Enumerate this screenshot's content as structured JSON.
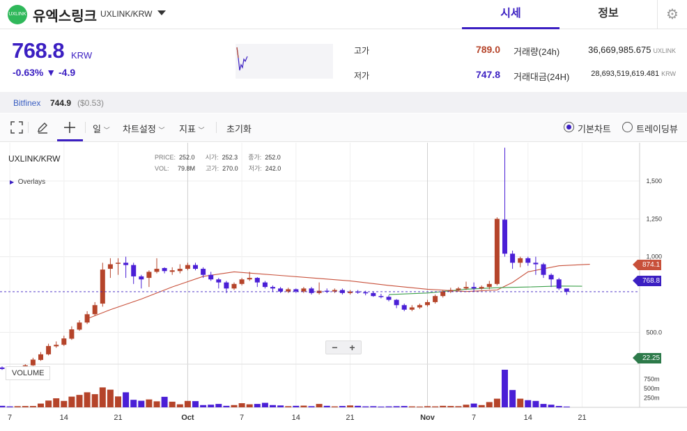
{
  "header": {
    "logo_text": "UXLINK",
    "coin_name": "유엑스링크",
    "pair": "UXLINK/KRW",
    "tabs": [
      {
        "label": "시세",
        "active": true
      },
      {
        "label": "정보",
        "active": false
      }
    ]
  },
  "summary": {
    "price": "768.8",
    "price_unit": "KRW",
    "change_pct": "-0.63%",
    "change_abs": "▼ -4.9",
    "high_label": "고가",
    "high_value": "789.0",
    "low_label": "저가",
    "low_value": "747.8",
    "vol_label": "거래량(24h)",
    "vol_value": "36,669,985.675",
    "vol_unit": "UXLINK",
    "amount_label": "거래대금(24H)",
    "amount_value": "28,693,519,619.481",
    "amount_unit": "KRW"
  },
  "exchange": {
    "name": "Bitfinex",
    "price": "744.9",
    "usd": "($0.53)"
  },
  "toolbar": {
    "interval": "일",
    "chart_settings": "차트설정",
    "indicators": "지표",
    "reset": "초기화",
    "basic_chart": "기본차트",
    "tradingview": "트레이딩뷰"
  },
  "chart_labels": {
    "pair": "UXLINK/KRW",
    "overlays": "Overlays",
    "volume": "VOLUME",
    "ohlc": {
      "price_k": "PRICE:",
      "price_v": "252.0",
      "open_k": "시가:",
      "open_v": "252.3",
      "close_k": "종가:",
      "close_v": "252.0",
      "vol_k": "VOL:",
      "vol_v": "79.8M",
      "high_k": "고가:",
      "high_v": "270.0",
      "low_k": "저가:",
      "low_v": "242.0"
    },
    "tag_ma": "874.1",
    "tag_price": "768.8",
    "tag_bottom": "22.25",
    "zoom_minus": "−",
    "zoom_plus": "+"
  },
  "colors": {
    "accent": "#3b1fc2",
    "up": "#b5442a",
    "down": "#4a1fd6",
    "ma_red": "#c8503a",
    "ma_green": "#3ca04a"
  },
  "chart_data": {
    "type": "candlestick",
    "x_ticks": [
      "7",
      "14",
      "21",
      "Oct",
      "7",
      "14",
      "21",
      "Nov",
      "7",
      "14",
      "21"
    ],
    "y_ticks": [
      "1,500",
      "1,250",
      "1,000",
      "500.0"
    ],
    "volume_ticks": [
      "750m",
      "500m",
      "250m"
    ],
    "candles": [
      {
        "o": 268,
        "c": 258,
        "h": 275,
        "l": 252,
        "v": 40
      },
      {
        "o": 262,
        "c": 257,
        "h": 266,
        "l": 250,
        "v": 25
      },
      {
        "o": 255,
        "c": 270,
        "h": 276,
        "l": 250,
        "v": 30
      },
      {
        "o": 266,
        "c": 282,
        "h": 290,
        "l": 262,
        "v": 34
      },
      {
        "o": 282,
        "c": 320,
        "h": 332,
        "l": 278,
        "v": 35
      },
      {
        "o": 318,
        "c": 355,
        "h": 370,
        "l": 312,
        "v": 100
      },
      {
        "o": 355,
        "c": 410,
        "h": 425,
        "l": 348,
        "v": 180
      },
      {
        "o": 408,
        "c": 418,
        "h": 440,
        "l": 398,
        "v": 240
      },
      {
        "o": 418,
        "c": 460,
        "h": 478,
        "l": 410,
        "v": 170
      },
      {
        "o": 458,
        "c": 520,
        "h": 540,
        "l": 450,
        "v": 285
      },
      {
        "o": 518,
        "c": 565,
        "h": 580,
        "l": 510,
        "v": 330
      },
      {
        "o": 565,
        "c": 620,
        "h": 640,
        "l": 555,
        "v": 400
      },
      {
        "o": 620,
        "c": 680,
        "h": 700,
        "l": 610,
        "v": 350
      },
      {
        "o": 690,
        "c": 915,
        "h": 960,
        "l": 670,
        "v": 530
      },
      {
        "o": 920,
        "c": 950,
        "h": 990,
        "l": 860,
        "v": 470
      },
      {
        "o": 955,
        "c": 960,
        "h": 990,
        "l": 880,
        "v": 290
      },
      {
        "o": 960,
        "c": 945,
        "h": 1000,
        "l": 860,
        "v": 400
      },
      {
        "o": 945,
        "c": 870,
        "h": 960,
        "l": 820,
        "v": 200
      },
      {
        "o": 870,
        "c": 850,
        "h": 880,
        "l": 790,
        "v": 175
      },
      {
        "o": 860,
        "c": 900,
        "h": 910,
        "l": 800,
        "v": 210
      },
      {
        "o": 900,
        "c": 920,
        "h": 990,
        "l": 890,
        "v": 160
      },
      {
        "o": 925,
        "c": 905,
        "h": 930,
        "l": 890,
        "v": 280
      },
      {
        "o": 900,
        "c": 910,
        "h": 930,
        "l": 880,
        "v": 150
      },
      {
        "o": 905,
        "c": 920,
        "h": 950,
        "l": 890,
        "v": 80
      },
      {
        "o": 920,
        "c": 945,
        "h": 960,
        "l": 910,
        "v": 170
      },
      {
        "o": 945,
        "c": 920,
        "h": 960,
        "l": 910,
        "v": 165
      },
      {
        "o": 920,
        "c": 880,
        "h": 930,
        "l": 860,
        "v": 60
      },
      {
        "o": 880,
        "c": 850,
        "h": 900,
        "l": 840,
        "v": 70
      },
      {
        "o": 850,
        "c": 830,
        "h": 860,
        "l": 790,
        "v": 90
      },
      {
        "o": 830,
        "c": 790,
        "h": 840,
        "l": 760,
        "v": 40
      },
      {
        "o": 790,
        "c": 820,
        "h": 830,
        "l": 780,
        "v": 60
      },
      {
        "o": 820,
        "c": 850,
        "h": 860,
        "l": 810,
        "v": 110
      },
      {
        "o": 850,
        "c": 860,
        "h": 900,
        "l": 840,
        "v": 80
      },
      {
        "o": 860,
        "c": 830,
        "h": 865,
        "l": 800,
        "v": 90
      },
      {
        "o": 830,
        "c": 800,
        "h": 840,
        "l": 790,
        "v": 120
      },
      {
        "o": 800,
        "c": 790,
        "h": 810,
        "l": 770,
        "v": 60
      },
      {
        "o": 790,
        "c": 770,
        "h": 800,
        "l": 760,
        "v": 50
      },
      {
        "o": 770,
        "c": 785,
        "h": 795,
        "l": 760,
        "v": 30
      },
      {
        "o": 785,
        "c": 770,
        "h": 790,
        "l": 760,
        "v": 40
      },
      {
        "o": 770,
        "c": 790,
        "h": 800,
        "l": 760,
        "v": 45
      },
      {
        "o": 790,
        "c": 760,
        "h": 800,
        "l": 750,
        "v": 30
      },
      {
        "o": 760,
        "c": 775,
        "h": 830,
        "l": 750,
        "v": 90
      },
      {
        "o": 775,
        "c": 770,
        "h": 790,
        "l": 760,
        "v": 40
      },
      {
        "o": 770,
        "c": 780,
        "h": 790,
        "l": 760,
        "v": 25
      },
      {
        "o": 780,
        "c": 760,
        "h": 790,
        "l": 750,
        "v": 35
      },
      {
        "o": 760,
        "c": 770,
        "h": 780,
        "l": 750,
        "v": 50
      },
      {
        "o": 770,
        "c": 765,
        "h": 780,
        "l": 755,
        "v": 40
      },
      {
        "o": 765,
        "c": 760,
        "h": 775,
        "l": 745,
        "v": 25
      },
      {
        "o": 760,
        "c": 740,
        "h": 770,
        "l": 735,
        "v": 30
      },
      {
        "o": 740,
        "c": 735,
        "h": 755,
        "l": 725,
        "v": 20
      },
      {
        "o": 735,
        "c": 715,
        "h": 745,
        "l": 705,
        "v": 25
      },
      {
        "o": 715,
        "c": 680,
        "h": 720,
        "l": 660,
        "v": 30
      },
      {
        "o": 680,
        "c": 650,
        "h": 690,
        "l": 640,
        "v": 35
      },
      {
        "o": 650,
        "c": 665,
        "h": 680,
        "l": 640,
        "v": 25
      },
      {
        "o": 665,
        "c": 680,
        "h": 690,
        "l": 655,
        "v": 20
      },
      {
        "o": 680,
        "c": 700,
        "h": 715,
        "l": 670,
        "v": 30
      },
      {
        "o": 700,
        "c": 740,
        "h": 750,
        "l": 690,
        "v": 25
      },
      {
        "o": 740,
        "c": 770,
        "h": 780,
        "l": 730,
        "v": 40
      },
      {
        "o": 770,
        "c": 780,
        "h": 795,
        "l": 760,
        "v": 35
      },
      {
        "o": 780,
        "c": 790,
        "h": 800,
        "l": 770,
        "v": 30
      },
      {
        "o": 790,
        "c": 800,
        "h": 835,
        "l": 780,
        "v": 70
      },
      {
        "o": 800,
        "c": 790,
        "h": 830,
        "l": 770,
        "v": 100
      },
      {
        "o": 790,
        "c": 800,
        "h": 810,
        "l": 780,
        "v": 60
      },
      {
        "o": 800,
        "c": 820,
        "h": 840,
        "l": 785,
        "v": 140
      },
      {
        "o": 820,
        "c": 1250,
        "h": 1260,
        "l": 810,
        "v": 230
      },
      {
        "o": 1245,
        "c": 1020,
        "h": 1720,
        "l": 1000,
        "v": 1000
      },
      {
        "o": 1020,
        "c": 960,
        "h": 1040,
        "l": 920,
        "v": 460
      },
      {
        "o": 960,
        "c": 990,
        "h": 1000,
        "l": 930,
        "v": 230
      },
      {
        "o": 990,
        "c": 960,
        "h": 1000,
        "l": 940,
        "v": 190
      },
      {
        "o": 960,
        "c": 950,
        "h": 1000,
        "l": 880,
        "v": 170
      },
      {
        "o": 950,
        "c": 880,
        "h": 960,
        "l": 860,
        "v": 90
      },
      {
        "o": 880,
        "c": 850,
        "h": 890,
        "l": 800,
        "v": 70
      },
      {
        "o": 850,
        "c": 790,
        "h": 860,
        "l": 780,
        "v": 35
      },
      {
        "o": 790,
        "c": 768.8,
        "h": 789,
        "l": 747.8,
        "v": 20
      }
    ],
    "ma_red": [
      [
        11,
        590
      ],
      [
        14,
        650
      ],
      [
        18,
        720
      ],
      [
        22,
        800
      ],
      [
        26,
        870
      ],
      [
        30,
        900
      ],
      [
        35,
        880
      ],
      [
        40,
        860
      ],
      [
        45,
        840
      ],
      [
        50,
        810
      ],
      [
        55,
        785
      ],
      [
        60,
        770
      ],
      [
        64,
        780
      ],
      [
        66,
        830
      ],
      [
        68,
        900
      ],
      [
        72,
        940
      ],
      [
        76,
        950
      ]
    ],
    "ma_green": [
      [
        50,
        750
      ],
      [
        55,
        760
      ],
      [
        60,
        785
      ],
      [
        64,
        795
      ],
      [
        68,
        800
      ],
      [
        72,
        806
      ],
      [
        75,
        805
      ]
    ],
    "current_price": 768.8,
    "y_range": [
      290,
      1730
    ],
    "vol_range": [
      0,
      1000
    ]
  }
}
